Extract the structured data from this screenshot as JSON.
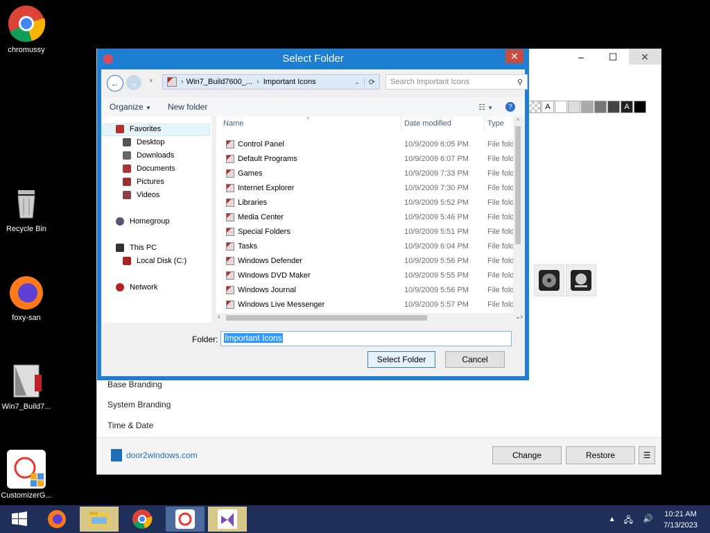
{
  "desktop_icons": [
    {
      "label": "chromussy",
      "icon": "chrome-icon"
    },
    {
      "label": "Recycle Bin",
      "icon": "recycle-bin-icon"
    },
    {
      "label": "foxy-san",
      "icon": "firefox-icon"
    },
    {
      "label": "Win7_Build7...",
      "icon": "build-folder-icon"
    },
    {
      "label": "CustomizerG...",
      "icon": "customizer-icon"
    }
  ],
  "app_window": {
    "list_items": [
      "Base Branding",
      "System Branding",
      "Time & Date"
    ],
    "logo_text": "door2windows.com",
    "buttons": {
      "change": "Change",
      "restore": "Restore",
      "menu": "☰"
    },
    "swatch_label": "A"
  },
  "dialog": {
    "title": "Select Folder",
    "address": {
      "segments": [
        "Win7_Build7600_...",
        "Important Icons"
      ]
    },
    "search_placeholder": "Search Important Icons",
    "toolbar": {
      "organize": "Organize",
      "new_folder": "New folder"
    },
    "nav": {
      "favorites": "Favorites",
      "favorites_items": [
        "Desktop",
        "Downloads",
        "Documents",
        "Pictures",
        "Videos"
      ],
      "homegroup": "Homegroup",
      "this_pc": "This PC",
      "this_pc_items": [
        "Local Disk (C:)"
      ],
      "network": "Network"
    },
    "columns": {
      "name": "Name",
      "date": "Date modified",
      "type": "Type"
    },
    "files": [
      {
        "name": "Control Panel",
        "date": "10/9/2009 6:05 PM",
        "type": "File fold"
      },
      {
        "name": "Default Programs",
        "date": "10/9/2009 6:07 PM",
        "type": "File fold"
      },
      {
        "name": "Games",
        "date": "10/9/2009 7:33 PM",
        "type": "File fold"
      },
      {
        "name": "Internet Explorer",
        "date": "10/9/2009 7:30 PM",
        "type": "File fold"
      },
      {
        "name": "Libraries",
        "date": "10/9/2009 5:52 PM",
        "type": "File fold"
      },
      {
        "name": "Media Center",
        "date": "10/9/2009 5:46 PM",
        "type": "File fold"
      },
      {
        "name": "Special Folders",
        "date": "10/9/2009 5:51 PM",
        "type": "File fold"
      },
      {
        "name": "Tasks",
        "date": "10/9/2009 6:04 PM",
        "type": "File fold"
      },
      {
        "name": "Windows Defender",
        "date": "10/9/2009 5:56 PM",
        "type": "File fold"
      },
      {
        "name": "Windows DVD Maker",
        "date": "10/9/2009 5:55 PM",
        "type": "File fold"
      },
      {
        "name": "Windows Journal",
        "date": "10/9/2009 5:56 PM",
        "type": "File fold"
      },
      {
        "name": "Windows Live Messenger",
        "date": "10/9/2009 5:57 PM",
        "type": "File fold"
      }
    ],
    "folder_label": "Folder:",
    "folder_value": "Important Icons",
    "select_button": "Select Folder",
    "cancel_button": "Cancel"
  },
  "taskbar": {
    "time": "10:21 AM",
    "date": "7/13/2023",
    "apps": [
      "start-icon",
      "firefox-icon",
      "file-explorer-icon",
      "chrome-icon",
      "customizer-icon",
      "visual-studio-icon"
    ]
  }
}
